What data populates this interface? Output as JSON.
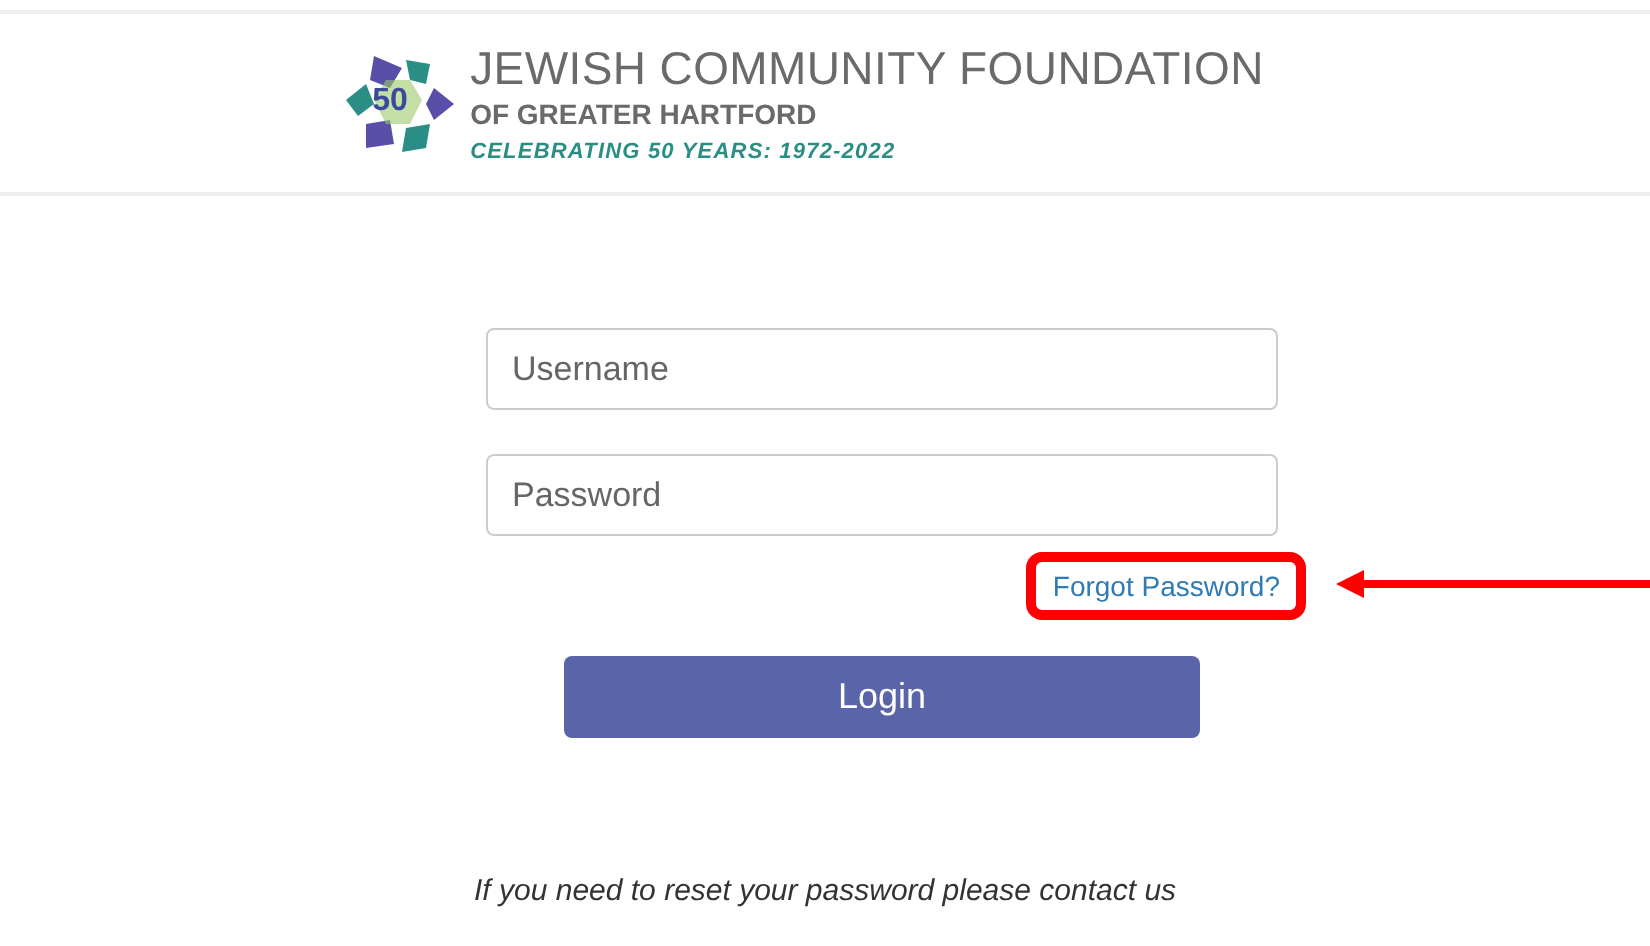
{
  "header": {
    "logo_mark": "50",
    "title": "JEWISH COMMUNITY FOUNDATION",
    "subtitle": "OF GREATER HARTFORD",
    "tagline": "CELEBRATING 50 YEARS: 1972-2022"
  },
  "form": {
    "fields": [
      {
        "placeholder": "Username"
      },
      {
        "placeholder": "Password"
      }
    ],
    "forgot_link": {
      "label": "Forgot Password?",
      "highlighted": true
    },
    "login_button": "Login"
  },
  "footer_note": "If you need to reset your password please contact us"
}
